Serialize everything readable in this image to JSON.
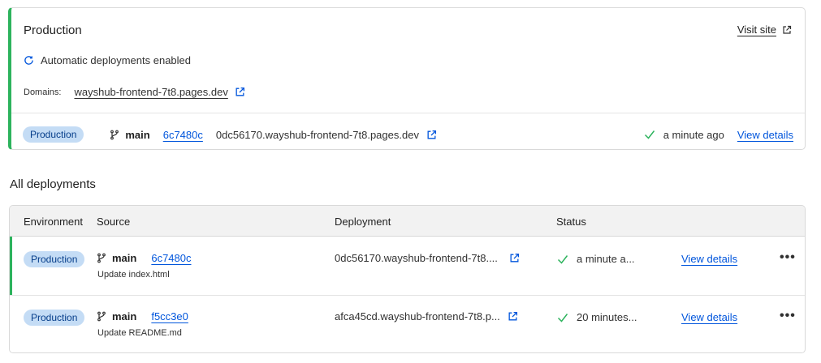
{
  "production_card": {
    "title": "Production",
    "visit_site_label": "Visit site",
    "auto_deploy_text": "Automatic deployments enabled",
    "domains_label": "Domains:",
    "domain": "wayshub-frontend-7t8.pages.dev",
    "current": {
      "environment": "Production",
      "branch": "main",
      "commit": "6c7480c",
      "deployment_url": "0dc56170.wayshub-frontend-7t8.pages.dev",
      "status_time": "a minute ago",
      "view_details_label": "View details"
    }
  },
  "all_deployments": {
    "title": "All deployments",
    "columns": [
      "Environment",
      "Source",
      "Deployment",
      "Status"
    ],
    "rows": [
      {
        "environment": "Production",
        "branch": "main",
        "commit": "6c7480c",
        "message": "Update index.html",
        "deployment": "0dc56170.wayshub-frontend-7t8....",
        "status": "a minute a...",
        "view_details_label": "View details",
        "more_label": "•••"
      },
      {
        "environment": "Production",
        "branch": "main",
        "commit": "f5cc3e0",
        "message": "Update README.md",
        "deployment": "afca45cd.wayshub-frontend-7t8.p...",
        "status": "20 minutes...",
        "view_details_label": "View details",
        "more_label": "•••"
      }
    ]
  },
  "colors": {
    "accent_green": "#2db35d",
    "link_blue": "#0055dc",
    "badge_bg": "#c4dcf5",
    "badge_text": "#053d8a"
  },
  "icons": {
    "refresh": "refresh-icon",
    "external_link": "external-link-icon",
    "branch": "git-branch-icon",
    "check": "check-icon",
    "more": "more-horizontal-icon"
  }
}
